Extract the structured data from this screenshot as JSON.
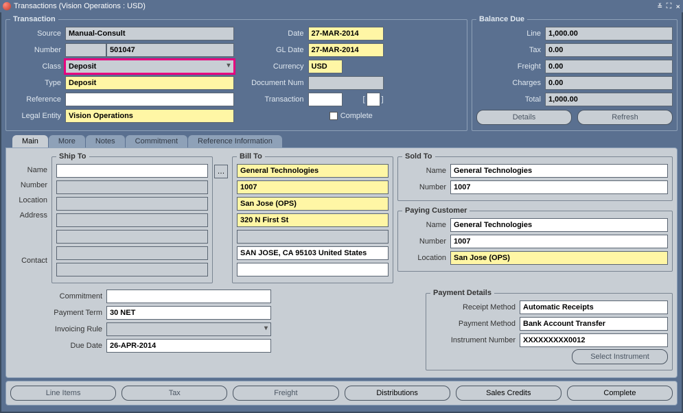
{
  "window": {
    "title": "Transactions (Vision Operations : USD)"
  },
  "transaction": {
    "legend": "Transaction",
    "labels": {
      "source": "Source",
      "number": "Number",
      "class": "Class",
      "type": "Type",
      "reference": "Reference",
      "legal_entity": "Legal Entity",
      "date": "Date",
      "gl_date": "GL Date",
      "currency": "Currency",
      "document_num": "Document Num",
      "transaction": "Transaction",
      "complete": "Complete"
    },
    "values": {
      "source": "Manual-Consult",
      "number_prefix": "",
      "number": "501047",
      "class": "Deposit",
      "type": "Deposit",
      "reference": "",
      "legal_entity": "Vision Operations",
      "date": "27-MAR-2014",
      "gl_date": "27-MAR-2014",
      "currency": "USD",
      "document_num": "",
      "transaction": ""
    }
  },
  "balance": {
    "legend": "Balance Due",
    "labels": {
      "line": "Line",
      "tax": "Tax",
      "freight": "Freight",
      "charges": "Charges",
      "total": "Total"
    },
    "values": {
      "line": "1,000.00",
      "tax": "0.00",
      "freight": "0.00",
      "charges": "0.00",
      "total": "1,000.00"
    },
    "buttons": {
      "details": "Details",
      "refresh": "Refresh"
    }
  },
  "tabs": [
    "Main",
    "More",
    "Notes",
    "Commitment",
    "Reference Information"
  ],
  "shipto": {
    "legend": "Ship To",
    "labels": {
      "name": "Name",
      "number": "Number",
      "location": "Location",
      "address": "Address",
      "contact": "Contact"
    },
    "values": {
      "name": "",
      "number": "",
      "location": "",
      "address1": "",
      "address2": "",
      "address3": "",
      "contact": ""
    }
  },
  "billto": {
    "legend": "Bill To",
    "values": {
      "name": "General Technologies",
      "number": "1007",
      "location": "San Jose (OPS)",
      "address1": "320 N First St",
      "address2": "",
      "address3": "SAN JOSE, CA 95103 United States",
      "contact": ""
    }
  },
  "soldto": {
    "legend": "Sold To",
    "labels": {
      "name": "Name",
      "number": "Number"
    },
    "values": {
      "name": "General Technologies",
      "number": "1007"
    }
  },
  "paying": {
    "legend": "Paying Customer",
    "labels": {
      "name": "Name",
      "number": "Number",
      "location": "Location"
    },
    "values": {
      "name": "General Technologies",
      "number": "1007",
      "location": "San Jose (OPS)"
    }
  },
  "misc": {
    "labels": {
      "commitment": "Commitment",
      "payment_term": "Payment Term",
      "invoicing_rule": "Invoicing Rule",
      "due_date": "Due Date"
    },
    "values": {
      "commitment": "",
      "payment_term": "30 NET",
      "invoicing_rule": "",
      "due_date": "26-APR-2014"
    }
  },
  "payment": {
    "legend": "Payment Details",
    "labels": {
      "receipt_method": "Receipt Method",
      "payment_method": "Payment Method",
      "instrument_number": "Instrument Number"
    },
    "values": {
      "receipt_method": "Automatic Receipts",
      "payment_method": "Bank Account Transfer",
      "instrument_number": "XXXXXXXXX0012"
    },
    "buttons": {
      "select_instrument": "Select Instrument"
    }
  },
  "bottom_buttons": {
    "line_items": "Line Items",
    "tax": "Tax",
    "freight": "Freight",
    "distributions": "Distributions",
    "sales_credits": "Sales Credits",
    "complete": "Complete"
  }
}
